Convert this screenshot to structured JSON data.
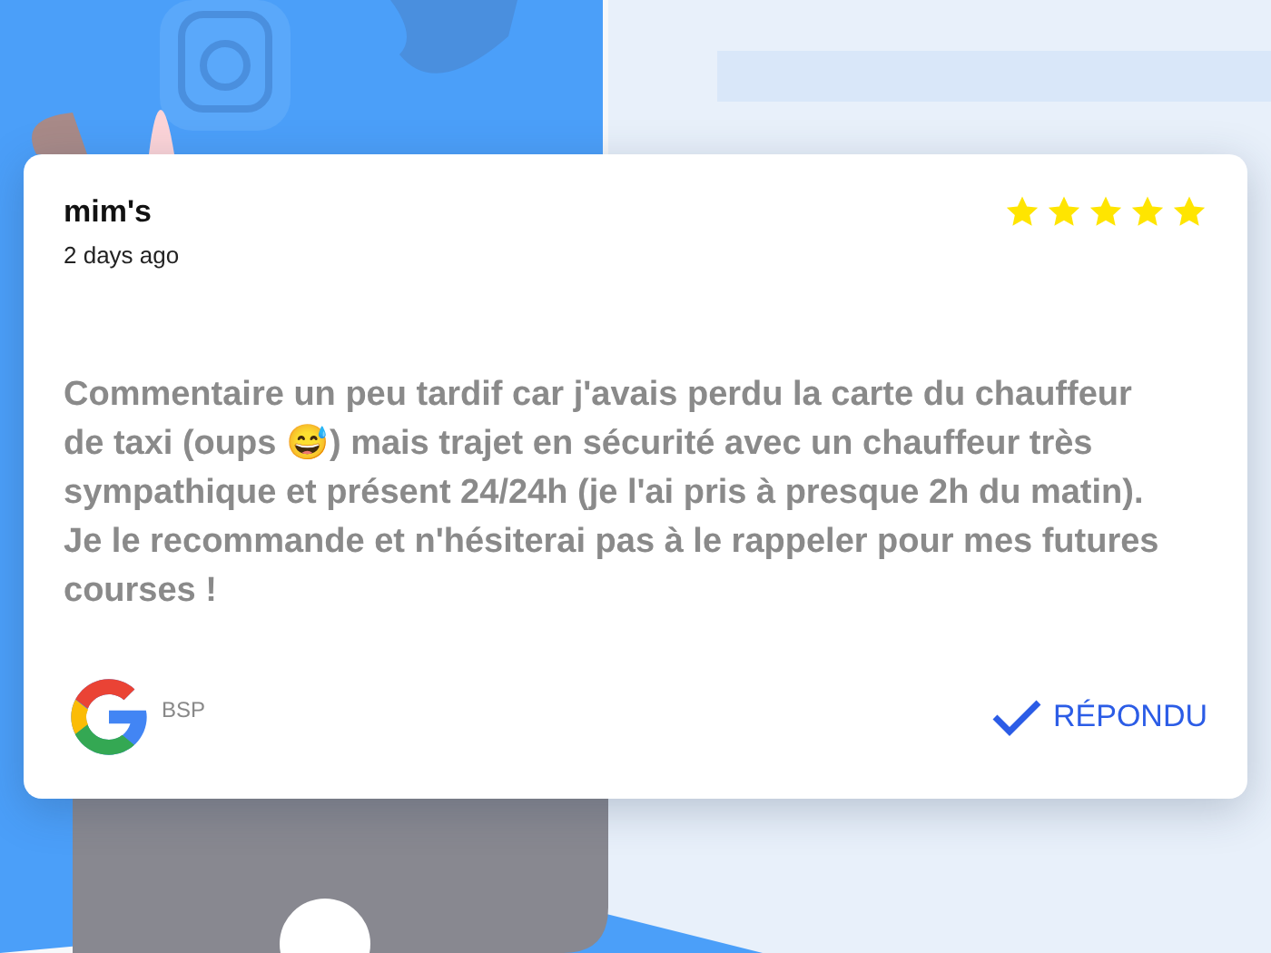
{
  "review": {
    "author": "mim's",
    "time": "2 days ago",
    "stars": 5,
    "text": "Commentaire un peu tardif car j'avais perdu la carte du chauffeur de taxi (oups 😅) mais trajet en sécurité avec un chauffeur très sympathique et présent 24/24h (je l'ai pris à presque 2h du matin). Je le recommande et n'hésiterai pas à le rappeler pour mes futures courses !",
    "source": "BSP",
    "status": "RÉPONDU"
  }
}
